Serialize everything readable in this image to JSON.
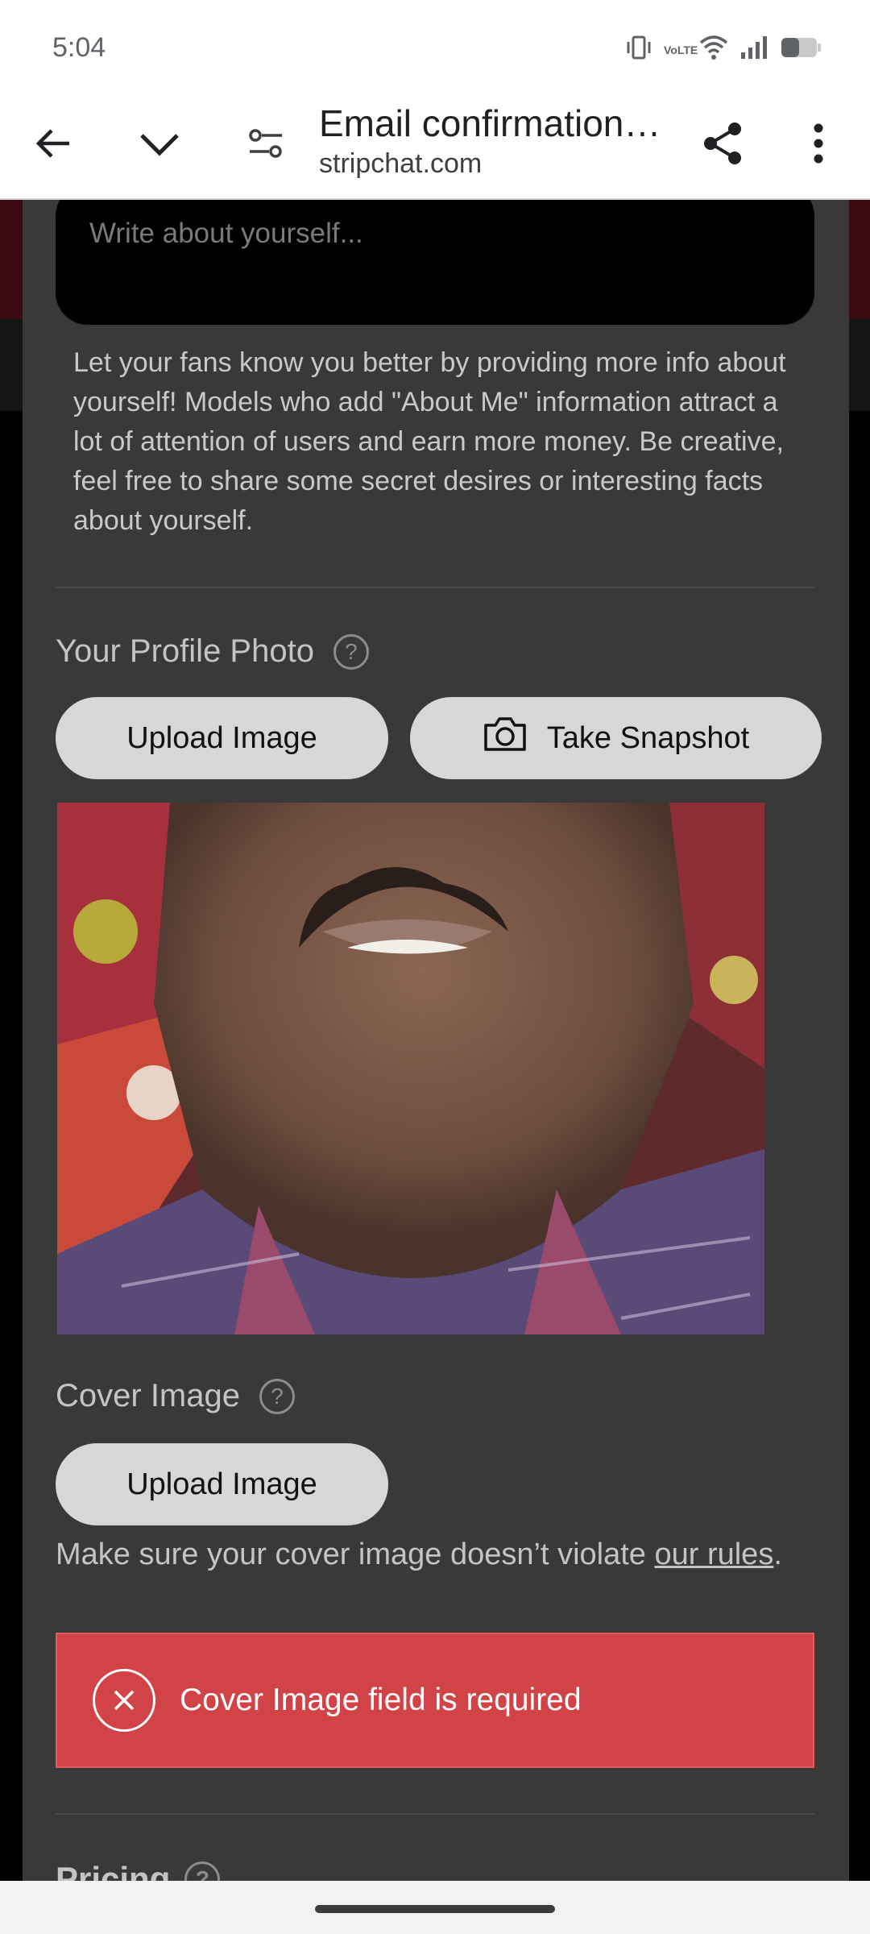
{
  "status_bar": {
    "time": "5:04",
    "icons": [
      "vibrate-icon",
      "volte-icon",
      "wifi-icon",
      "signal-icon",
      "battery-icon"
    ],
    "volte_text": "VoLTE"
  },
  "browser": {
    "page_title": "Email confirmation…",
    "url": "stripchat.com",
    "icons": [
      "back-arrow-icon",
      "chevron-down-icon",
      "site-settings-icon",
      "share-icon",
      "more-vert-icon"
    ]
  },
  "about": {
    "placeholder": "Write about yourself...",
    "help_text": "Let your fans know you better by providing more info about yourself! Models who add \"About Me\" information attract a lot of attention of users and earn more money. Be creative, feel free to share some secret desires or interesting facts about yourself."
  },
  "profile_photo": {
    "label": "Your Profile Photo",
    "help_mark": "?",
    "upload_label": "Upload Image",
    "snapshot_label": "Take Snapshot"
  },
  "cover_image": {
    "label": "Cover Image",
    "help_mark": "?",
    "upload_label": "Upload Image",
    "note_prefix": "Make sure your cover image doesn’t violate ",
    "note_link": "our rules",
    "note_suffix": "."
  },
  "error": {
    "message": "Cover Image field is required"
  },
  "pricing": {
    "label": "Pricing",
    "help_mark": "?"
  },
  "colors": {
    "modal_bg": "#393939",
    "error_bg": "#d14346",
    "pill_bg": "#d7d7d7"
  }
}
